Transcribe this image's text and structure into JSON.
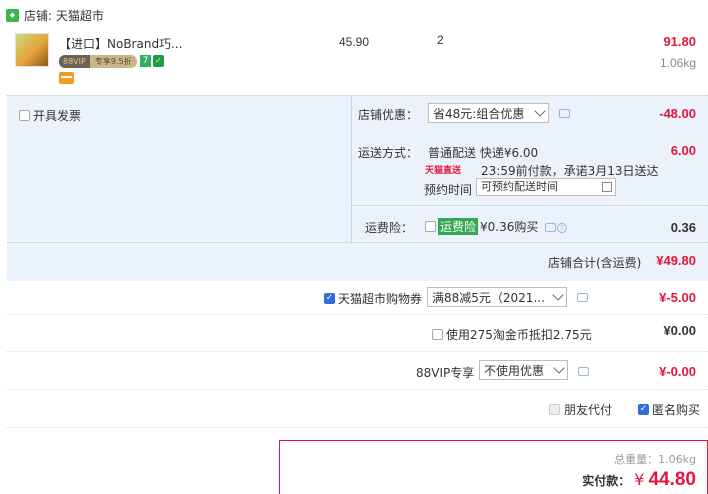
{
  "shop": {
    "label": "店铺: 天猫超市",
    "icon": "tmall-shop-icon"
  },
  "product": {
    "title": "【进口】NoBrand巧...",
    "vip_tag": "88VIP",
    "vip_text": "专享9.5折",
    "badge_7": "7",
    "badge_shield": "✓",
    "price": "45.90",
    "qty": "2",
    "subtotal": "91.80",
    "weight": "1.06kg"
  },
  "service": {
    "invoice_label": "开具发票",
    "discount_label": "店铺优惠：",
    "discount_select": "省48元:组合优惠",
    "discount_amount": "-48.00",
    "shipping_label": "运送方式：",
    "shipping_value": "普通配送 快递¥6.00",
    "shipping_amount": "6.00",
    "tmall_direct": "天猫直送",
    "delivery_promise": "23:59前付款，承诺3月13日送达",
    "schedule_label": "预约时间",
    "schedule_placeholder": "可预约配送时间",
    "insurance_label": "运费险：",
    "insurance_badge": "运费险",
    "insurance_text": "¥0.36购买",
    "insurance_amount": "0.36",
    "shop_total_label": "店铺合计(含运费)",
    "shop_total": "¥49.80"
  },
  "coupon": {
    "label": "天猫超市购物券",
    "select": "满88减5元（2021...",
    "amount": "¥-5.00"
  },
  "coins": {
    "label": "使用275淘金币抵扣2.75元",
    "amount": "¥0.00"
  },
  "vip88": {
    "label": "88VIP专享",
    "select": "不使用优惠",
    "amount": "¥-0.00"
  },
  "options": {
    "friend_pay": "朋友代付",
    "anonymous": "匿名购买"
  },
  "summary": {
    "weight_label": "总重量：1.06kg",
    "pay_label": "实付款：",
    "currency": "¥",
    "pay_amount": "44.80"
  },
  "colors": {
    "accent_red": "#e4163c",
    "panel_blue": "#ebf2fb",
    "check_blue": "#2f6fd6"
  }
}
